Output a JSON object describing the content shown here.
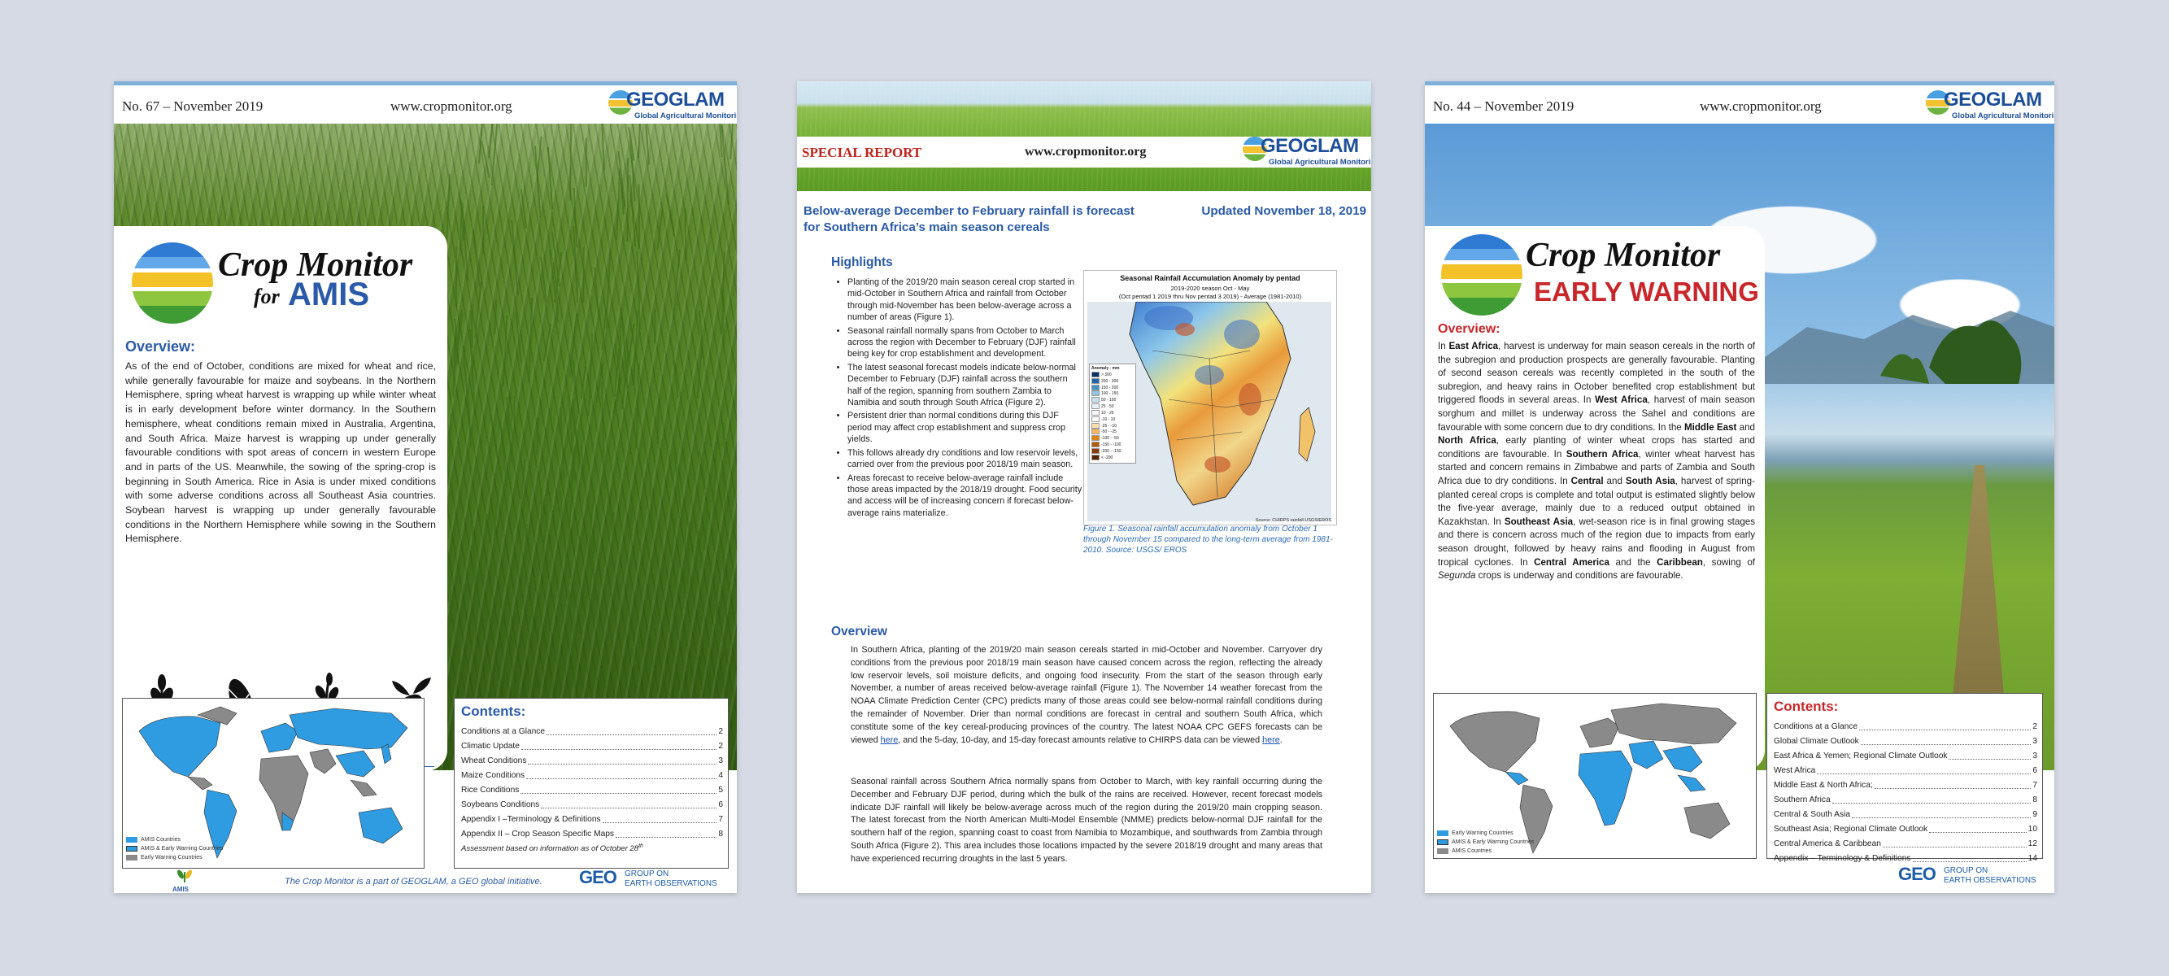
{
  "doc1": {
    "issue": "No. 67 – November 2019",
    "url": "www.cropmonitor.org",
    "logo": {
      "word": "GEOGLAM",
      "sub": "Global Agricultural Monitoring"
    },
    "title_line1": "Crop Monitor",
    "title_for": "for",
    "title_line2": "AMIS",
    "overview_heading": "Overview:",
    "overview_text": "As of the end of October, conditions are mixed for wheat and rice, while generally favourable for maize and soybeans. In the Northern Hemisphere, spring wheat harvest is wrapping up while winter wheat is in early development before winter dormancy. In the Southern hemisphere, wheat conditions remain mixed in Australia, Argentina, and South Africa. Maize harvest is wrapping up under generally favourable conditions with spot areas of concern in western Europe and in parts of the US. Meanwhile, the sowing of the spring-crop is beginning in South America. Rice in Asia is under mixed conditions with some adverse conditions across all Southeast Asia countries. Soybean harvest is wrapping up under generally favourable conditions in the Northern Hemisphere while sowing in the Southern Hemisphere.",
    "icons": [
      "wheat-icon",
      "maize-icon",
      "rice-icon",
      "soybean-icon"
    ],
    "legend": [
      "AMIS Countries",
      "AMIS & Early Warning Countries",
      "Early Warning Countries"
    ],
    "contents_heading": "Contents:",
    "contents": [
      {
        "title": "Conditions at a Glance",
        "page": "2"
      },
      {
        "title": "Climatic Update",
        "page": "2"
      },
      {
        "title": "Wheat Conditions",
        "page": "3"
      },
      {
        "title": "Maize Conditions",
        "page": "4"
      },
      {
        "title": "Rice Conditions",
        "page": "5"
      },
      {
        "title": "Soybeans Conditions",
        "page": "6"
      },
      {
        "title": "Appendix I –Terminology & Definitions",
        "page": "7"
      },
      {
        "title": "Appendix II – Crop Season Specific Maps",
        "page": "8"
      }
    ],
    "assessment_note": "Assessment based on information as of October 28",
    "assessment_sup": "th",
    "amis_label": "AMIS",
    "footer": "The Crop Monitor is a part of GEOGLAM, a GEO global initiative.",
    "geo": {
      "mark": "GEO",
      "line1": "GROUP ON",
      "line2": "EARTH OBSERVATIONS"
    },
    "colors": {
      "blue": "#2f9be0",
      "gray": "#8a8a8a",
      "heading": "#2a5aa8"
    }
  },
  "doc2": {
    "special": "SPECIAL REPORT",
    "url": "www.cropmonitor.org",
    "logo": {
      "word": "GEOGLAM",
      "sub": "Global Agricultural Monitoring"
    },
    "title": "Below-average December to February rainfall is forecast for Southern Africa’s main season cereals",
    "updated": "Updated November 18, 2019",
    "highlights_heading": "Highlights",
    "highlights": [
      "Planting of the 2019/20 main season cereal crop started in mid-October in Southern Africa and rainfall from October through mid-November has been below-average across a number of areas (Figure 1).",
      "Seasonal rainfall normally spans from October to March across the region with December to February (DJF) rainfall being key for crop establishment and development.",
      "The latest seasonal forecast models indicate below-normal December to February (DJF) rainfall across the southern half of the region, spanning from southern Zambia to Namibia and south through South Africa (Figure 2).",
      "Persistent drier than normal conditions during this DJF period may affect crop establishment and suppress crop yields.",
      "This follows already dry conditions and low reservoir levels, carried over from the previous poor 2018/19 main season.",
      "Areas forecast to receive below-average rainfall include those areas impacted by the 2018/19 drought. Food security and access will be of increasing concern if forecast below-average rains materialize."
    ],
    "figure": {
      "title": "Seasonal Rainfall Accumulation Anomaly by pentad",
      "sub1": "2019-2020 season Oct - May",
      "sub2": "(Oct pentad 1 2019 thru Nov pentad 3 2019) - Average (1981-2010)",
      "source": "Source: CHIRPS rainfall USGS/EROS",
      "legend_title": "Anomaly - mm",
      "legend_values": [
        "> 300",
        "200 - 300",
        "150 - 200",
        "100 - 150",
        "50 - 100",
        "25 - 50",
        "10 - 25",
        "-10 - 10",
        "-25 - -10",
        "-50 - -25",
        "-100 - -50",
        "-150 - -100",
        "-200 - -150",
        "< -200"
      ]
    },
    "caption": "Figure 1. Seasonal rainfall accumulation anomaly from October 1 through November 15 compared to the long-term average from 1981-2010.  Source: USGS/ EROS",
    "overview_heading": "Overview",
    "p1_a": "In Southern Africa, planting of the 2019/20 main season cereals started in mid-October and November. Carryover dry conditions from the previous poor 2018/19 main season have caused concern across the region, reflecting the already low reservoir levels, soil moisture deficits, and ongoing food insecurity. From the start of the season through early November, a number of areas received below-average rainfall (Figure 1). The November 14 weather forecast from the NOAA Climate Prediction Center (CPC) predicts many of those areas could see below-normal rainfall conditions during the remainder of November.  Drier than normal conditions are forecast in central and southern South Africa, which constitute some of the key cereal-producing provinces of the country. The latest NOAA CPC GEFS forecasts can be viewed ",
    "p1_link1": "here",
    "p1_b": ", and the 5-day, 10-day, and 15-day forecast amounts relative to CHIRPS data can be viewed ",
    "p1_link2": "here",
    "p1_c": ".",
    "p2": "Seasonal rainfall across Southern Africa normally spans from October to March, with key rainfall occurring during the December and February DJF period, during which the bulk of the rains are received. However, recent forecast models indicate DJF rainfall will likely be below-average across much of the region during the 2019/20 main cropping season. The latest forecast from the North American Multi-Model Ensemble (NMME) predicts below-normal DJF rainfall for the southern half of the region, spanning coast to coast from Namibia to Mozambique, and southwards from Zambia through South Africa (Figure 2). This area includes those locations impacted by the severe 2018/19 drought and many areas that have experienced recurring droughts in the last 5 years."
  },
  "doc3": {
    "issue": "No. 44 – November 2019",
    "url": "www.cropmonitor.org",
    "logo": {
      "word": "GEOGLAM",
      "sub": "Global Agricultural Monitoring"
    },
    "title_line1": "Crop Monitor",
    "title_line2": "EARLY WARNING",
    "overview_heading": "Overview:",
    "overview_html_parts": [
      [
        "In ",
        ""
      ],
      [
        "East Africa",
        "b"
      ],
      [
        ", harvest is underway for main season cereals in the north of the subregion and production prospects are generally favourable. Planting of second season cereals was recently completed in the south of the subregion, and heavy rains in October benefited crop establishment but triggered floods in several areas. In ",
        ""
      ],
      [
        "West Africa",
        "b"
      ],
      [
        ", harvest of main season sorghum and millet is underway across the Sahel and conditions are favourable with some concern due to dry conditions. In the ",
        ""
      ],
      [
        "Middle East",
        "b"
      ],
      [
        " and ",
        ""
      ],
      [
        "North Africa",
        "b"
      ],
      [
        ", early planting of winter wheat crops has started and conditions are favourable. In ",
        ""
      ],
      [
        "Southern Africa",
        "b"
      ],
      [
        ", winter wheat harvest has started and concern remains in Zimbabwe and parts of Zambia and South Africa due to dry conditions. In ",
        ""
      ],
      [
        "Central",
        "b"
      ],
      [
        " and ",
        ""
      ],
      [
        "South Asia",
        "b"
      ],
      [
        ", harvest of spring-planted cereal crops is complete and total output is estimated slightly below the five-year average, mainly due to a reduced output obtained in Kazakhstan. In ",
        ""
      ],
      [
        "Southeast Asia",
        "b"
      ],
      [
        ", wet-season rice is in final growing stages and there is concern across much of the region due to impacts from early season drought, followed by heavy rains and flooding in August from tropical cyclones. In ",
        ""
      ],
      [
        "Central America",
        "b"
      ],
      [
        " and the ",
        ""
      ],
      [
        "Caribbean",
        "b"
      ],
      [
        ", sowing of ",
        ""
      ],
      [
        "Segunda",
        "i"
      ],
      [
        " crops is underway and conditions are favourable.",
        ""
      ]
    ],
    "icons": [
      "maize-icon",
      "sorghum-icon",
      "millet-icon",
      "wheat-icon",
      "beans-icon",
      "rice-icon",
      "cassava-icon"
    ],
    "legend": [
      "Early Warning Countries",
      "AMIS & Early Warning Countries",
      "AMIS Countries"
    ],
    "contents_heading": "Contents:",
    "contents": [
      {
        "title": "Conditions at a Glance",
        "page": "2"
      },
      {
        "title": "Global Climate Outlook",
        "page": "3"
      },
      {
        "title": "East Africa & Yemen; Regional Climate Outlook",
        "page": "3"
      },
      {
        "title": "West Africa",
        "page": "6"
      },
      {
        "title": "Middle East & North Africa;",
        "page": "7"
      },
      {
        "title": "Southern Africa",
        "page": "8"
      },
      {
        "title": "Central & South Asia",
        "page": "9"
      },
      {
        "title": "Southeast Asia; Regional Climate Outlook",
        "page": "10"
      },
      {
        "title": "Central America & Caribbean",
        "page": "12"
      },
      {
        "title": "Appendix – Terminology & Definitions",
        "page": "14"
      }
    ],
    "geo": {
      "mark": "GEO",
      "line1": "GROUP ON",
      "line2": "EARTH OBSERVATIONS"
    }
  }
}
